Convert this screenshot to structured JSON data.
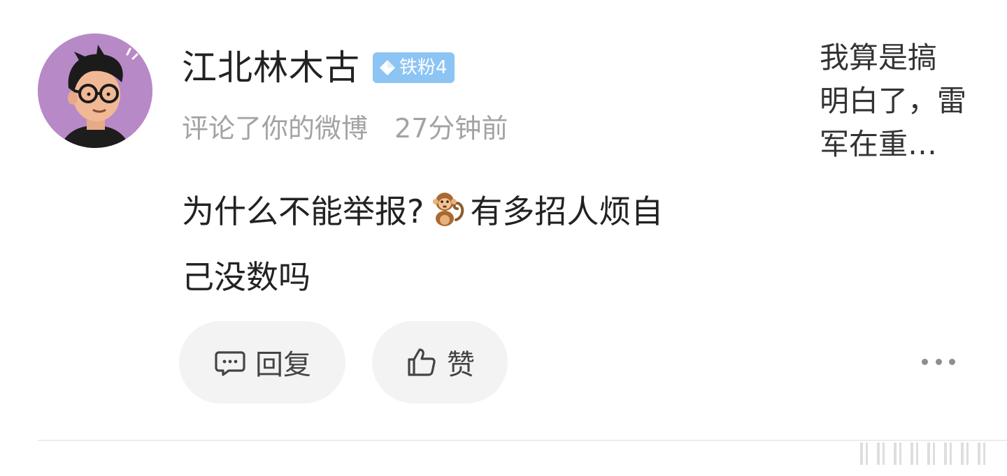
{
  "notification": {
    "user": {
      "name": "江北林木古",
      "badge_label": "铁粉4"
    },
    "action_text": "评论了你的微博",
    "time_text": "27分钟前",
    "comment": {
      "line1_before_emoji": "为什么不能举报?",
      "emoji": "monkey-emoji",
      "line1_after_emoji": "有多招人烦自",
      "line2": "己没数吗"
    },
    "buttons": {
      "reply_label": "回复",
      "like_label": "赞"
    },
    "original_post_preview": {
      "line1": "我算是搞",
      "line2": "明白了，雷",
      "line3": "军在重…"
    }
  },
  "icons": {
    "avatar": "cartoon-man-with-glasses-avatar",
    "badge": "diamond-icon",
    "reply": "comment-bubble-icon",
    "like": "thumbs-up-icon",
    "more": "more-horizontal-icon"
  },
  "colors": {
    "avatar_bg": "#b889c7",
    "badge_bg": "#8cc4f4",
    "meta_text": "#a3a3a3",
    "button_bg": "#f3f3f3"
  }
}
